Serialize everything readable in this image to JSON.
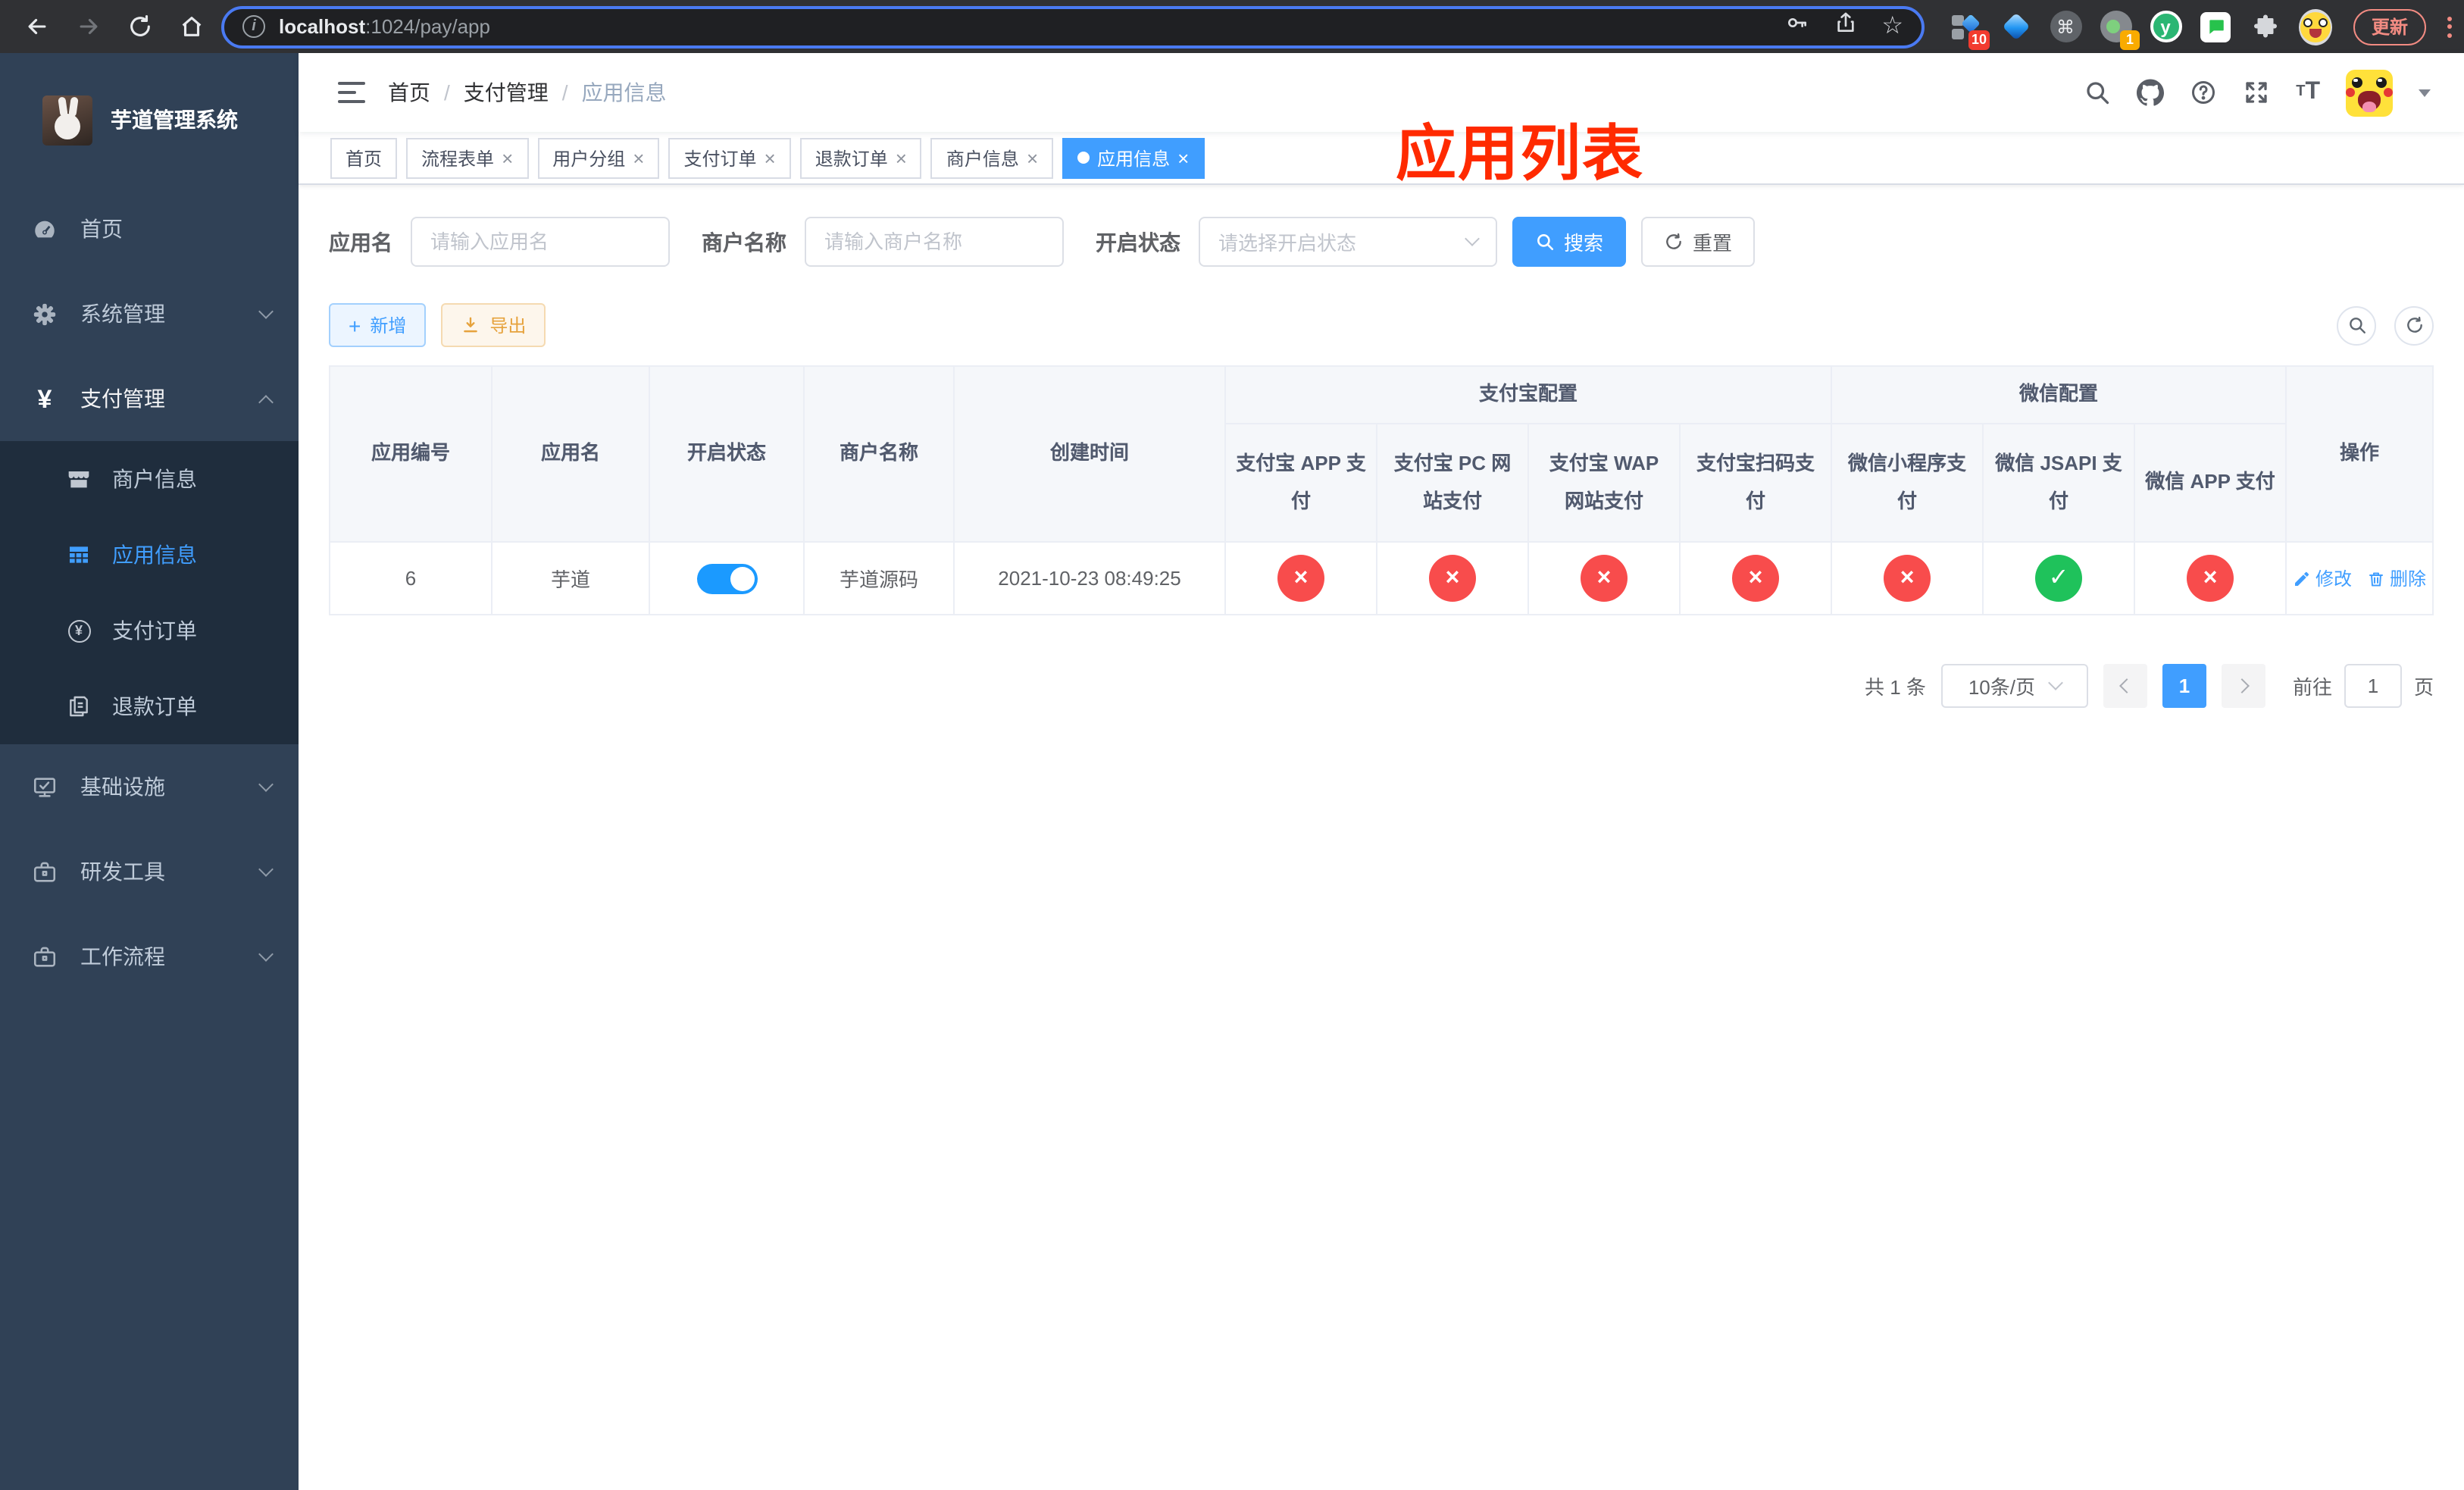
{
  "browser": {
    "url_host": "localhost",
    "url_path": ":1024/pay/app",
    "badge_blocks": "10",
    "badge_proxy": "1",
    "ext_y": "y",
    "update_label": "更新"
  },
  "icons": {
    "cross": "×",
    "check": "✓",
    "yen": "¥",
    "question": "?",
    "command": "⌘",
    "star": "☆",
    "info": "i",
    "plus": "+",
    "tt": "T"
  },
  "sidebar": {
    "title": "芋道管理系统",
    "menu": [
      {
        "label": "首页"
      },
      {
        "label": "系统管理"
      },
      {
        "label": "支付管理"
      },
      {
        "label": "基础设施"
      },
      {
        "label": "研发工具"
      },
      {
        "label": "工作流程"
      }
    ],
    "submenu": [
      {
        "label": "商户信息"
      },
      {
        "label": "应用信息"
      },
      {
        "label": "支付订单"
      },
      {
        "label": "退款订单"
      }
    ]
  },
  "breadcrumb": {
    "items": [
      "首页",
      "支付管理",
      "应用信息"
    ],
    "separator": "/"
  },
  "annotation": {
    "text": "应用列表",
    "color": "#ff2a00"
  },
  "tags": [
    "首页",
    "流程表单",
    "用户分组",
    "支付订单",
    "退款订单",
    "商户信息",
    "应用信息"
  ],
  "filters": {
    "name_label": "应用名",
    "name_placeholder": "请输入应用名",
    "merchant_label": "商户名称",
    "merchant_placeholder": "请输入商户名称",
    "status_label": "开启状态",
    "status_placeholder": "请选择开启状态",
    "search_label": "搜索",
    "reset_label": "重置"
  },
  "toolbar": {
    "add_label": "新增",
    "export_label": "导出"
  },
  "table": {
    "groups": {
      "alipay": "支付宝配置",
      "wechat": "微信配置"
    },
    "cols": [
      "应用编号",
      "应用名",
      "开启状态",
      "商户名称",
      "创建时间"
    ],
    "subcols": [
      "支付宝 APP 支付",
      "支付宝 PC 网站支付",
      "支付宝 WAP 网站支付",
      "支付宝扫码支付",
      "微信小程序支付",
      "微信 JSAPI 支付",
      "微信 APP 支付"
    ],
    "ops_label": "操作",
    "row": {
      "id": "6",
      "name": "芋道",
      "enabled": true,
      "merchant": "芋道源码",
      "created": "2021-10-23 08:49:25",
      "statuses": [
        false,
        false,
        false,
        false,
        false,
        true,
        false
      ],
      "edit_label": "修改",
      "delete_label": "删除"
    }
  },
  "pagination": {
    "total": "共 1 条",
    "size": "10条/页",
    "page": "1",
    "goto_label": "前往",
    "goto_value": "1",
    "unit": "页"
  },
  "colors": {
    "primary": "#409eff",
    "success": "#1fc25b",
    "danger": "#f84c4c",
    "annotation": "#ff2a00",
    "sidebar_bg": "#304156",
    "submenu_bg": "#1f2d3d"
  }
}
